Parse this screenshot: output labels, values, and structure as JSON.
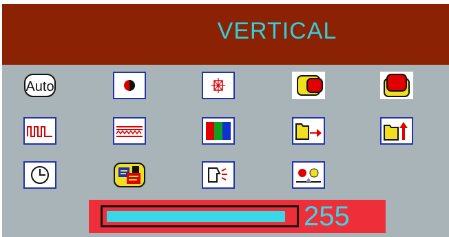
{
  "osd": {
    "title": "VERTICAL",
    "colors": {
      "header_bg": "#8a2203",
      "panel_bg": "#a9b4b8",
      "accent": "#2fd0e0",
      "bar_bg": "#ee2e38"
    },
    "icons": [
      {
        "name": "auto-adjust-icon",
        "label": "Auto"
      },
      {
        "name": "contrast-icon"
      },
      {
        "name": "brightness-icon"
      },
      {
        "name": "horizontal-position-icon"
      },
      {
        "name": "vertical-position-icon"
      },
      {
        "name": "clock-pulse-icon"
      },
      {
        "name": "phase-icon"
      },
      {
        "name": "color-bars-icon"
      },
      {
        "name": "h-size-icon"
      },
      {
        "name": "v-size-icon"
      },
      {
        "name": "timer-icon"
      },
      {
        "name": "language-icon"
      },
      {
        "name": "recall-icon"
      },
      {
        "name": "color-temp-icon"
      }
    ],
    "slider": {
      "value_text": "255",
      "fill_fraction": 0.96
    }
  }
}
